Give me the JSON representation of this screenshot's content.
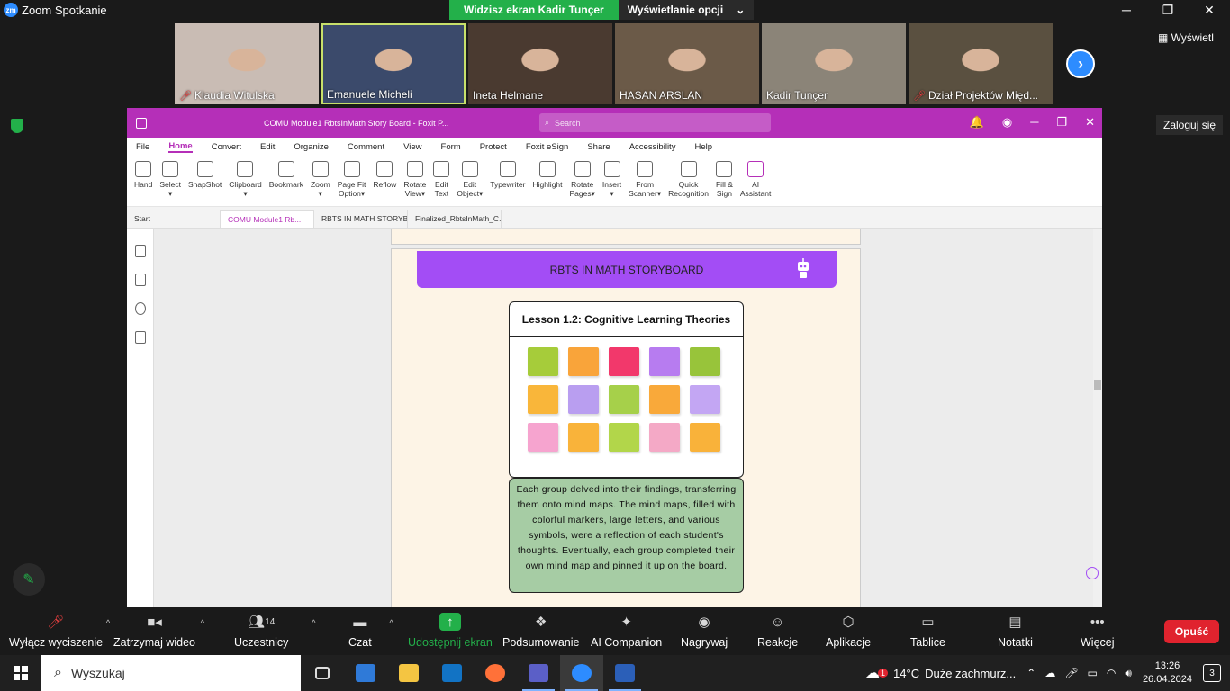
{
  "zoom": {
    "logo": "zm",
    "title": "Zoom Spotkanie",
    "share_banner": "Widzisz ekran Kadir Tunçer",
    "view_options": "Wyświetlanie opcji",
    "view_button": "Wyświetl",
    "login": "Zaloguj się",
    "participants": [
      {
        "name": "Klaudia Witulska",
        "muted": true,
        "bg": "#c9bcb4"
      },
      {
        "name": "Emanuele Micheli",
        "muted": false,
        "bg": "#3b4a6b"
      },
      {
        "name": "Ineta Helmane",
        "muted": false,
        "bg": "#4a3a30"
      },
      {
        "name": "HASAN ARSLAN",
        "muted": false,
        "bg": "#6b5a48"
      },
      {
        "name": "Kadir Tunçer",
        "muted": false,
        "bg": "#8b8478"
      },
      {
        "name": "Dział Projektów Międ...",
        "muted": true,
        "bg": "#5a5040"
      }
    ],
    "bottom": {
      "mute": "Wyłącz wyciszenie",
      "video": "Zatrzymaj wideo",
      "participants": "Uczestnicy",
      "participants_count": "14",
      "chat": "Czat",
      "share": "Udostępnij ekran",
      "summary": "Podsumowanie",
      "ai": "AI Companion",
      "record": "Nagrywaj",
      "reactions": "Reakcje",
      "apps": "Aplikacje",
      "whiteboards": "Tablice",
      "notes": "Notatki",
      "more": "Więcej",
      "leave": "Opuść"
    }
  },
  "foxit": {
    "doc_title": "COMU Module1 RbtsInMath Story Board - Foxit P...",
    "search_placeholder": "Search",
    "menu": [
      "File",
      "Home",
      "Convert",
      "Edit",
      "Organize",
      "Comment",
      "View",
      "Form",
      "Protect",
      "Foxit eSign",
      "Share",
      "Accessibility",
      "Help"
    ],
    "tools": [
      {
        "l1": "Hand",
        "l2": ""
      },
      {
        "l1": "Select",
        "l2": "▾"
      },
      {
        "l1": "SnapShot",
        "l2": ""
      },
      {
        "l1": "Clipboard",
        "l2": "▾"
      },
      {
        "l1": "Bookmark",
        "l2": ""
      },
      {
        "l1": "Zoom",
        "l2": "▾"
      },
      {
        "l1": "Page Fit",
        "l2": "Option▾"
      },
      {
        "l1": "Reflow",
        "l2": ""
      },
      {
        "l1": "Rotate",
        "l2": "View▾"
      },
      {
        "l1": "Edit",
        "l2": "Text"
      },
      {
        "l1": "Edit",
        "l2": "Object▾"
      },
      {
        "l1": "Typewriter",
        "l2": ""
      },
      {
        "l1": "Highlight",
        "l2": ""
      },
      {
        "l1": "Rotate",
        "l2": "Pages▾"
      },
      {
        "l1": "Insert",
        "l2": "▾"
      },
      {
        "l1": "From",
        "l2": "Scanner▾"
      },
      {
        "l1": "Quick",
        "l2": "Recognition"
      },
      {
        "l1": "Fill &",
        "l2": "Sign"
      },
      {
        "l1": "AI",
        "l2": "Assistant"
      }
    ],
    "tabs": [
      "Start",
      "COMU Module1 Rb...",
      "RBTS IN MATH STORYB...",
      "Finalized_RbtsInMath_C..."
    ]
  },
  "page": {
    "header": "RBTS IN MATH STORYBOARD",
    "lesson_title": "Lesson 1.2: Cognitive Learning Theories",
    "notes": [
      "#a6cc3a",
      "#f9a43a",
      "#f2386b",
      "#b77cf0",
      "#98c43a",
      "#f9b63a",
      "#b99ef0",
      "#a6d04a",
      "#f9a93a",
      "#c3a6f3",
      "#f6a4cf",
      "#f9b33a",
      "#b2d64a",
      "#f4a9c6",
      "#f9b23a"
    ],
    "description": "Each group delved into their findings, transferring them onto mind maps. The mind maps, filled with colorful markers, large letters, and various symbols, were a reflection of each student's thoughts. Eventually, each group completed their own mind map and pinned it up on the board."
  },
  "taskbar": {
    "search": "Wyszukaj",
    "weather_temp": "14°C",
    "weather_text": "Duże zachmurz...",
    "time": "13:26",
    "date": "26.04.2024",
    "notifications": "3",
    "weather_badge": "1"
  }
}
